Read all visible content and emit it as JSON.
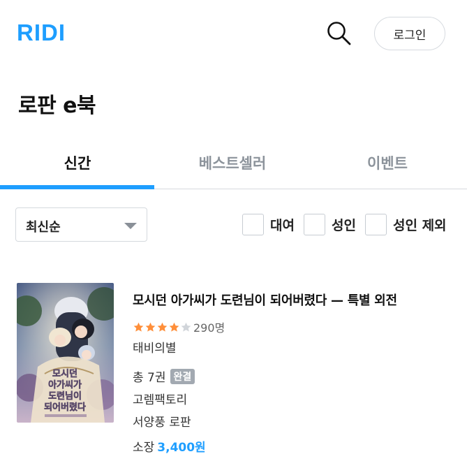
{
  "header": {
    "logo": "RIDI",
    "login_label": "로그인"
  },
  "page": {
    "title": "로판 e북"
  },
  "tabs": [
    {
      "label": "신간",
      "active": true
    },
    {
      "label": "베스트셀러",
      "active": false
    },
    {
      "label": "이벤트",
      "active": false
    }
  ],
  "sort": {
    "selected": "최신순"
  },
  "filters": [
    {
      "label": "대여",
      "checked": false
    },
    {
      "label": "성인",
      "checked": false
    },
    {
      "label": "성인 제외",
      "checked": false
    }
  ],
  "book": {
    "title": "모시던 아가씨가 도련님이 되어버렸다 — 특별 외전",
    "rating_stars": 4,
    "rating_count": "290명",
    "author": "태비의별",
    "volumes": "총 7권",
    "status_badge": "완결",
    "publisher": "고렘팩토리",
    "genre": "서양풍 로판",
    "price_label": "소장",
    "price": "3,400원",
    "cover_lettering": "모시던 아가씨가 도련님이 되어버렸다"
  },
  "colors": {
    "brand": "#1e9eff",
    "star_filled": "#ff8f3a",
    "star_empty": "#d1d5da",
    "badge_bg": "#a2a9b1"
  },
  "icons": {
    "search": "search-icon",
    "dropdown": "chevron-down-icon",
    "star": "star-icon"
  }
}
